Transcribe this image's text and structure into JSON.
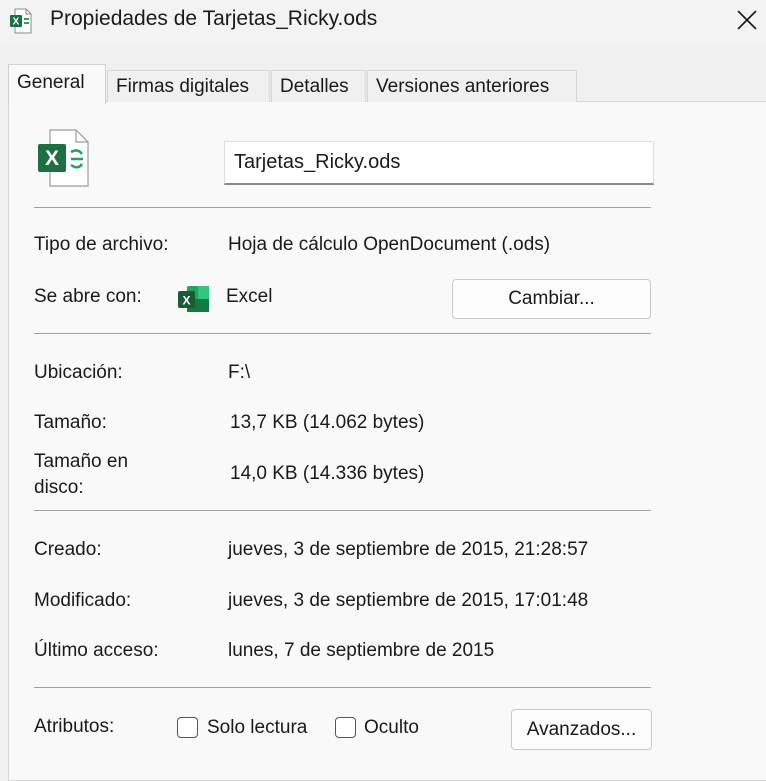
{
  "window": {
    "title": "Propiedades de Tarjetas_Ricky.ods",
    "title_icon": "excel-file-icon",
    "close_icon": "close-icon"
  },
  "tabs": [
    {
      "label": "General",
      "active": true
    },
    {
      "label": "Firmas digitales",
      "active": false
    },
    {
      "label": "Detalles",
      "active": false
    },
    {
      "label": "Versiones anteriores",
      "active": false
    }
  ],
  "general": {
    "file_name": "Tarjetas_Ricky.ods",
    "file_icon": "excel-document-icon",
    "file_type_label": "Tipo de archivo:",
    "file_type_value": "Hoja de cálculo OpenDocument (.ods)",
    "opens_with_label": "Se abre con:",
    "opens_with_app": "Excel",
    "opens_with_icon": "excel-app-icon",
    "change_button": "Cambiar...",
    "location_label": "Ubicación:",
    "location_value": "F:\\",
    "size_label": "Tamaño:",
    "size_value": "13,7 KB (14.062 bytes)",
    "size_on_disk_label_line1": "Tamaño en",
    "size_on_disk_label_line2": "disco:",
    "size_on_disk_value": "14,0 KB (14.336 bytes)",
    "created_label": "Creado:",
    "created_value": "jueves, 3 de septiembre de 2015, 21:28:57",
    "modified_label": "Modificado:",
    "modified_value": "jueves, 3 de septiembre de 2015, 17:01:48",
    "accessed_label": "Último acceso:",
    "accessed_value": "lunes, 7 de septiembre de 2015",
    "attributes_label": "Atributos:",
    "readonly_label": "Solo lectura",
    "readonly_checked": false,
    "hidden_label": "Oculto",
    "hidden_checked": false,
    "advanced_button": "Avanzados..."
  },
  "colors": {
    "excel_green": "#1d7044",
    "excel_light_green": "#21a366"
  }
}
